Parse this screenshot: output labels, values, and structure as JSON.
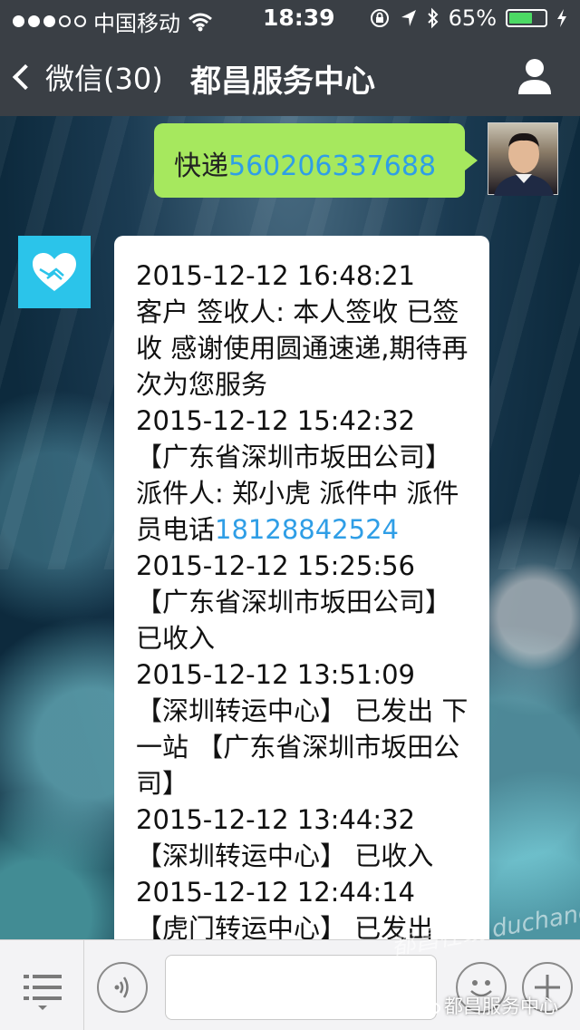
{
  "status_bar": {
    "carrier": "中国移动",
    "time": "18:39",
    "battery": "65%",
    "battery_level": 0.65,
    "signal_bars_filled": 3,
    "signal_bars_total": 5
  },
  "nav": {
    "back_label": "微信(30)",
    "title": "都昌服务中心"
  },
  "messages": {
    "outgoing": {
      "prefix": "快递",
      "tracking_number": "560206337688"
    },
    "incoming": {
      "lines": [
        "2015-12-12 16:48:21",
        "客户 签收人: 本人签收 已签收 感谢使用圆通速递,期待再次为您服务",
        "2015-12-12 15:42:32",
        "【广东省深圳市坂田公司】 派件人: 郑小虎 派件中 派件员电话",
        "2015-12-12 15:25:56",
        "【广东省深圳市坂田公司】 已收入",
        "2015-12-12 13:51:09",
        "【深圳转运中心】 已发出 下一站 【广东省深圳市坂田公司】",
        "2015-12-12 13:44:32",
        "【深圳转运中心】 已收入",
        "2015-12-12 12:44:14",
        "【虎门转运中心】 已发出"
      ],
      "phone": "18128842524"
    }
  },
  "watermarks": {
    "site": "都昌在线 duchang.org",
    "account": "都昌服务中心"
  },
  "icons": {
    "back": "chevron-left-icon",
    "profile": "person-icon",
    "official_account": "handshake-heart-icon",
    "menu": "list-menu-icon",
    "voice": "voice-icon",
    "emoji": "emoji-icon",
    "plus": "plus-icon"
  },
  "colors": {
    "nav_bg": "#3a3f45",
    "outgoing_bubble": "#a6e85e",
    "link": "#2f9ee6",
    "account_avatar": "#2bc4ea",
    "battery": "#4cd964"
  }
}
